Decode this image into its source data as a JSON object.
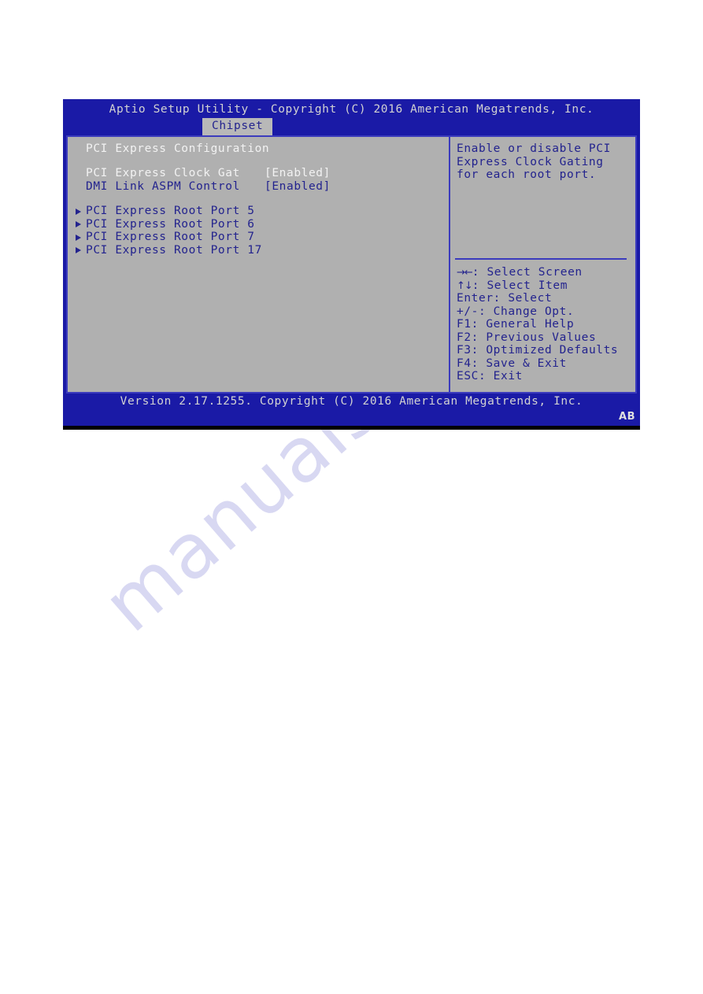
{
  "window": {
    "header_title": "Aptio Setup Utility - Copyright (C) 2016 American Megatrends, Inc.",
    "active_tab": "Chipset"
  },
  "colors": {
    "header_bg": "#1a1aa6",
    "panel_bg": "#b0b0b0",
    "panel_border": "#3b3bbd",
    "text_normal": "#23238e",
    "text_selected": "#f2f2f2",
    "header_text": "#d2d2d2",
    "tab_bg": "#b8b8b8"
  },
  "main": {
    "section_title": "PCI Express Configuration",
    "settings": [
      {
        "label": "PCI Express Clock Gat",
        "value": "[Enabled]",
        "selected": true
      },
      {
        "label": "DMI Link ASPM Control",
        "value": "[Enabled]",
        "selected": false
      }
    ],
    "submenus": [
      {
        "label": "PCI Express Root Port 5"
      },
      {
        "label": "PCI Express Root Port 6"
      },
      {
        "label": "PCI Express Root Port 7"
      },
      {
        "label": "PCI Express Root Port 17"
      }
    ]
  },
  "help": {
    "text": "Enable or disable PCI Express Clock Gating for each root port."
  },
  "key_legend": [
    {
      "key": "→←",
      "label": ": Select Screen",
      "glyph": true
    },
    {
      "key": "↑↓",
      "label": ": Select Item",
      "glyph": true
    },
    {
      "key": "Enter",
      "label": ": Select",
      "glyph": false
    },
    {
      "key": "+/-",
      "label": ": Change Opt.",
      "glyph": false
    },
    {
      "key": "F1",
      "label": ": General Help",
      "glyph": false
    },
    {
      "key": "F2",
      "label": ": Previous Values",
      "glyph": false
    },
    {
      "key": "F3",
      "label": ": Optimized Defaults",
      "glyph": false
    },
    {
      "key": "F4",
      "label": ": Save & Exit",
      "glyph": false
    },
    {
      "key": "ESC",
      "label": ": Exit",
      "glyph": false
    }
  ],
  "footer": {
    "version_text": "Version 2.17.1255. Copyright (C) 2016 American Megatrends, Inc.",
    "corner_mark": "AB"
  },
  "watermark": {
    "text": "manualshive"
  }
}
